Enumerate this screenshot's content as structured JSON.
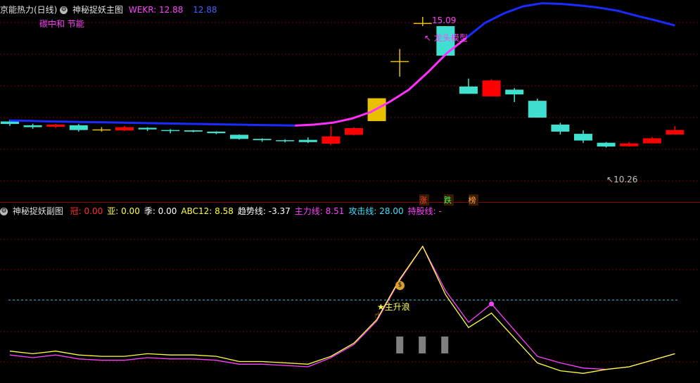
{
  "main_header": {
    "stock": "京能热力(日线)",
    "indicator": "神秘捉妖主图",
    "wekr_label": "WEKR: 12.88",
    "wekr_value2": "12.88"
  },
  "concept_tags": "碳中和 节能",
  "annotations": {
    "high_price": "15.09",
    "model_label": "龙头模型",
    "low_price": "10.26",
    "main_wave": "主升浪"
  },
  "rank_tags": [
    {
      "text": "涨",
      "color": "#ff4040"
    },
    {
      "text": "跌",
      "color": "#40ff40"
    },
    {
      "text": "榜",
      "color": "#ffaa40"
    }
  ],
  "sub_header": {
    "title": "神秘捉妖副图",
    "items": [
      {
        "label": "冠: 0.00",
        "color": "#ff3030"
      },
      {
        "label": "亚: 0.00",
        "color": "#ffff40"
      },
      {
        "label": "季: 0.00",
        "color": "#ffffff"
      },
      {
        "label": "ABC12: 8.58",
        "color": "#ffff40"
      },
      {
        "label": "趋势线: -3.37",
        "color": "#ffffff"
      },
      {
        "label": "主力线: 8.51",
        "color": "#ff40ff"
      },
      {
        "label": "攻击线: 28.00",
        "color": "#40e0ff"
      },
      {
        "label": "持股线: -",
        "color": "#ff40ff"
      }
    ]
  },
  "chart_data": [
    {
      "type": "candlestick",
      "title": "神秘捉妖主图",
      "candles": [
        {
          "o": 11.8,
          "c": 11.72,
          "h": 11.85,
          "l": 11.66,
          "color": "cyan"
        },
        {
          "o": 11.68,
          "c": 11.62,
          "h": 11.73,
          "l": 11.57,
          "color": "cyan"
        },
        {
          "o": 11.63,
          "c": 11.7,
          "h": 11.72,
          "l": 11.6,
          "color": "red"
        },
        {
          "o": 11.68,
          "c": 11.53,
          "h": 11.72,
          "l": 11.48,
          "color": "cyan"
        },
        {
          "o": 11.55,
          "c": 11.54,
          "h": 11.62,
          "l": 11.48,
          "color": "yellow"
        },
        {
          "o": 11.52,
          "c": 11.62,
          "h": 11.66,
          "l": 11.5,
          "color": "red"
        },
        {
          "o": 11.6,
          "c": 11.55,
          "h": 11.62,
          "l": 11.5,
          "color": "cyan"
        },
        {
          "o": 11.53,
          "c": 11.5,
          "h": 11.56,
          "l": 11.43,
          "color": "cyan"
        },
        {
          "o": 11.52,
          "c": 11.48,
          "h": 11.53,
          "l": 11.46,
          "color": "cyan"
        },
        {
          "o": 11.48,
          "c": 11.43,
          "h": 11.49,
          "l": 11.4,
          "color": "cyan"
        },
        {
          "o": 11.38,
          "c": 11.25,
          "h": 11.39,
          "l": 11.23,
          "color": "cyan"
        },
        {
          "o": 11.25,
          "c": 11.21,
          "h": 11.27,
          "l": 11.16,
          "color": "cyan"
        },
        {
          "o": 11.21,
          "c": 11.19,
          "h": 11.24,
          "l": 11.14,
          "color": "cyan"
        },
        {
          "o": 11.22,
          "c": 11.15,
          "h": 11.3,
          "l": 11.12,
          "color": "cyan"
        },
        {
          "o": 11.1,
          "c": 11.33,
          "h": 11.66,
          "l": 11.05,
          "color": "red"
        },
        {
          "o": 11.38,
          "c": 11.59,
          "h": 11.62,
          "l": 11.36,
          "color": "red"
        },
        {
          "o": 11.81,
          "c": 12.53,
          "h": 12.53,
          "l": 11.81,
          "color": "yellow"
        },
        {
          "o": 13.7,
          "c": 13.7,
          "h": 14.08,
          "l": 13.21,
          "color": "yellow"
        },
        {
          "o": 14.9,
          "c": 14.9,
          "h": 15.09,
          "l": 14.8,
          "color": "yellow"
        },
        {
          "o": 14.8,
          "c": 13.87,
          "h": 14.8,
          "l": 13.87,
          "color": "cyan"
        },
        {
          "o": 12.9,
          "c": 12.67,
          "h": 13.15,
          "l": 12.67,
          "color": "cyan"
        },
        {
          "o": 12.59,
          "c": 13.09,
          "h": 13.13,
          "l": 12.59,
          "color": "red"
        },
        {
          "o": 12.8,
          "c": 12.65,
          "h": 12.85,
          "l": 12.41,
          "color": "cyan"
        },
        {
          "o": 12.45,
          "c": 11.92,
          "h": 12.52,
          "l": 11.92,
          "color": "cyan"
        },
        {
          "o": 11.7,
          "c": 11.48,
          "h": 11.76,
          "l": 11.39,
          "color": "cyan"
        },
        {
          "o": 11.41,
          "c": 11.2,
          "h": 11.52,
          "l": 11.12,
          "color": "cyan"
        },
        {
          "o": 11.13,
          "c": 11.01,
          "h": 11.15,
          "l": 10.98,
          "color": "cyan"
        },
        {
          "o": 11.02,
          "c": 11.11,
          "h": 11.15,
          "l": 11.01,
          "color": "red"
        },
        {
          "o": 11.11,
          "c": 11.27,
          "h": 11.31,
          "l": 11.11,
          "color": "red"
        },
        {
          "o": 11.39,
          "c": 11.53,
          "h": 11.65,
          "l": 11.39,
          "color": "red"
        }
      ],
      "ma_line": [
        11.83,
        11.82,
        11.8,
        11.79,
        11.78,
        11.77,
        11.76,
        11.75,
        11.74,
        11.73,
        11.72,
        11.71,
        11.7,
        11.69,
        11.68,
        11.67,
        11.7,
        11.76,
        11.89,
        12.1,
        12.42,
        12.8,
        13.35,
        13.95,
        14.42,
        14.9,
        15.2,
        15.42,
        15.52,
        15.5,
        15.45,
        15.38,
        15.28,
        15.12,
        14.98,
        14.82
      ],
      "ma_color_low": "#1a2bff",
      "ma_color_high": "#ff30ff"
    },
    {
      "type": "line",
      "title": "神秘捉妖副图",
      "series": [
        {
          "name": "主力线",
          "color": "#ff40ff",
          "values": [
            0.16,
            0.14,
            0.16,
            0.13,
            0.12,
            0.12,
            0.14,
            0.13,
            0.13,
            0.12,
            0.09,
            0.09,
            0.08,
            0.07,
            0.14,
            0.24,
            0.42,
            0.73,
            0.99,
            0.65,
            0.41,
            0.55,
            0.35,
            0.15,
            0.1,
            0.06,
            0.05,
            0.07,
            0.12,
            0.17
          ]
        },
        {
          "name": "ABC12",
          "color": "#ffff40",
          "values": [
            0.19,
            0.17,
            0.19,
            0.16,
            0.15,
            0.15,
            0.17,
            0.16,
            0.16,
            0.15,
            0.11,
            0.11,
            0.1,
            0.09,
            0.15,
            0.25,
            0.43,
            0.74,
            0.99,
            0.62,
            0.37,
            0.48,
            0.29,
            0.1,
            0.04,
            0.02,
            0.05,
            0.07,
            0.12,
            0.17
          ]
        }
      ],
      "attack_line_level": 0.58,
      "volume_marks": [
        0.4,
        0.4,
        0.4
      ]
    }
  ]
}
